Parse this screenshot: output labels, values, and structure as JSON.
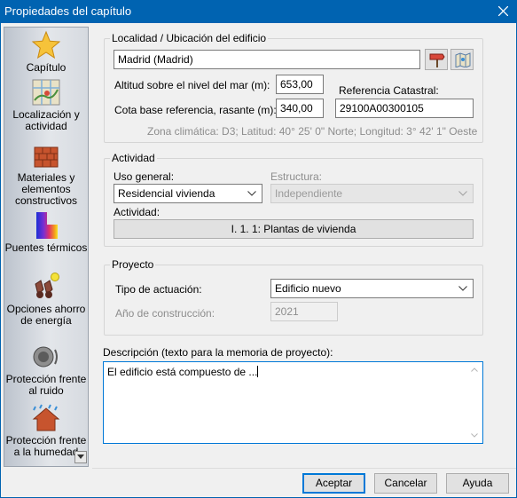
{
  "window": {
    "title": "Propiedades del capítulo"
  },
  "sidebar": {
    "items": [
      {
        "label": "Capítulo",
        "icon": "star-icon"
      },
      {
        "label": "Localización y actividad",
        "icon": "map-icon"
      },
      {
        "label": "Materiales y elementos constructivos",
        "icon": "bricks-icon"
      },
      {
        "label": "Puentes térmicos",
        "icon": "thermal-bridge-icon"
      },
      {
        "label": "Opciones ahorro de energía",
        "icon": "binoculars-icon"
      },
      {
        "label": "Protección frente al ruido",
        "icon": "speaker-icon"
      },
      {
        "label": "Protección frente a la humedad",
        "icon": "roof-rain-icon"
      }
    ]
  },
  "location": {
    "group_title": "Localidad / Ubicación del edificio",
    "city_value": "Madrid (Madrid)",
    "altitude_label": "Altitud sobre el nivel del mar (m):",
    "altitude_value": "653,00",
    "base_label": "Cota base referencia, rasante (m):",
    "base_value": "340,00",
    "cadastral_label": "Referencia Catastral:",
    "cadastral_value": "29100A00300105",
    "climate_info": "Zona climática: D3; Latitud: 40° 25' 0\" Norte; Longitud: 3° 42' 1\" Oeste"
  },
  "activity": {
    "group_title": "Actividad",
    "use_label": "Uso general:",
    "use_value": "Residencial vivienda",
    "structure_label": "Estructura:",
    "structure_value": "Independiente",
    "activity_label": "Actividad:",
    "activity_button": "I. 1. 1: Plantas de vivienda"
  },
  "project": {
    "group_title": "Proyecto",
    "type_label": "Tipo de actuación:",
    "type_value": "Edificio nuevo",
    "year_label": "Año de construcción:",
    "year_value": "2021"
  },
  "description": {
    "label": "Descripción (texto para la memoria de proyecto):",
    "value": "El edificio está compuesto de ..."
  },
  "buttons": {
    "accept": "Aceptar",
    "cancel": "Cancelar",
    "help": "Ayuda"
  }
}
